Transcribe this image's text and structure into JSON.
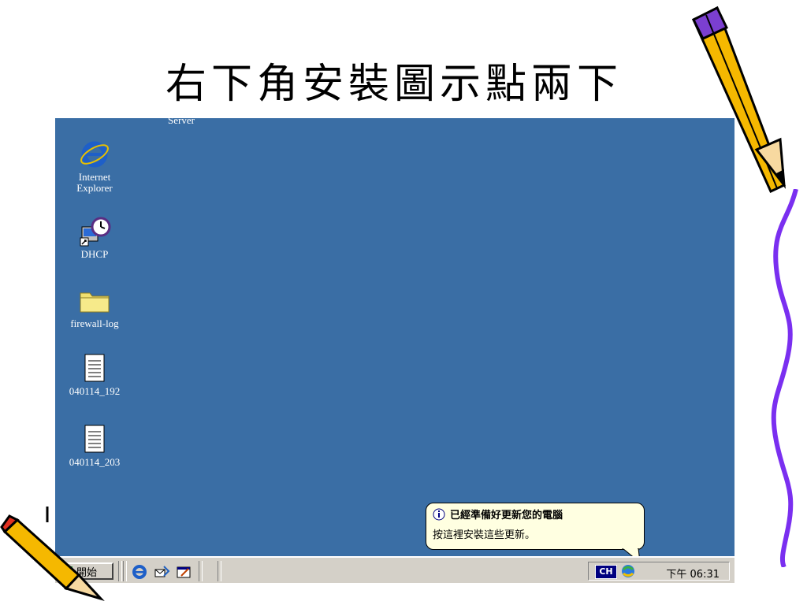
{
  "slide": {
    "title": "右下角安裝圖示點兩下"
  },
  "desktop": {
    "partial_label": "Server",
    "icons": [
      {
        "name": "Internet Explorer",
        "line1": "Internet",
        "line2": "Explorer",
        "icon": "ie-icon"
      },
      {
        "name": "DHCP",
        "line1": "DHCP",
        "icon": "dhcp-shortcut-icon"
      },
      {
        "name": "firewall-log",
        "line1": "firewall-log",
        "icon": "folder-icon"
      },
      {
        "name": "040114_192",
        "line1": "040114_192",
        "icon": "text-document-icon"
      },
      {
        "name": "040114_203",
        "line1": "040114_203",
        "icon": "text-document-icon"
      }
    ]
  },
  "taskbar": {
    "start_label": "開始",
    "quick_launch": [
      "ie-icon",
      "outlook-express-icon",
      "show-desktop-icon"
    ],
    "ime_label": "CH",
    "clock": "下午 06:31"
  },
  "balloon": {
    "title": "已經準備好更新您的電腦",
    "message": "按這裡安裝這些更新。"
  },
  "colors": {
    "desktop": "#3a6ea5",
    "taskbar": "#d4d0c8",
    "balloon": "#ffffe1"
  }
}
